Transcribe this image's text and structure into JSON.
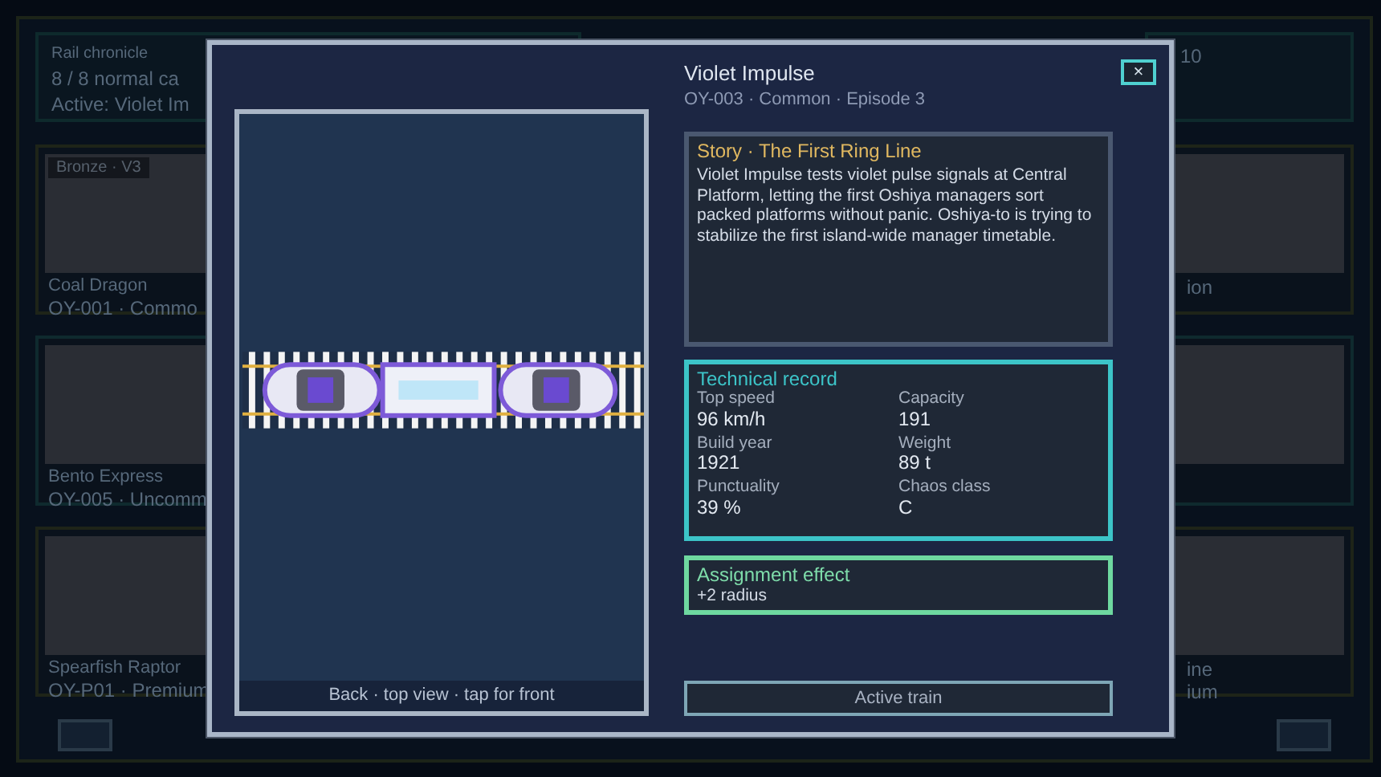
{
  "background": {
    "header": {
      "lines": [
        "Rail chronicle",
        "8 / 8 normal ca",
        "Active: Violet Im"
      ],
      "right_text": "10"
    },
    "left_cards": [
      {
        "badge": "Bronze · V3",
        "name": "Coal Dragon",
        "code": "OY-001 · Commo",
        "highlighted": false
      },
      {
        "name": "Bento Express",
        "code": "OY-005 · Uncomm",
        "highlighted": true
      },
      {
        "name": "Spearfish Raptor",
        "code": "OY-P01 · Premium",
        "highlighted": false
      }
    ],
    "right_cards": [
      {
        "lines": [
          "ion"
        ],
        "highlighted": false
      },
      {
        "highlighted": true
      },
      {
        "lines": [
          "ine",
          "ium"
        ],
        "highlighted": false
      }
    ]
  },
  "modal": {
    "title": "Violet Impulse",
    "subtitle": "OY-003 · Common · Episode 3",
    "close": "×",
    "preview_caption": "Back · top view · tap for front",
    "story": {
      "title": "Story · The First Ring Line",
      "text": "Violet Impulse tests violet pulse signals at Central Platform, letting the first Oshiya managers sort packed platforms without panic. Oshiya-to is trying to stabilize the first island-wide manager timetable."
    },
    "technical_record": {
      "title": "Technical record",
      "items": [
        {
          "label": "Top speed",
          "value": "96 km/h"
        },
        {
          "label": "Capacity",
          "value": "191"
        },
        {
          "label": "Build year",
          "value": "1921"
        },
        {
          "label": "Weight",
          "value": "89 t"
        },
        {
          "label": "Punctuality",
          "value": "39 %"
        },
        {
          "label": "Chaos class",
          "value": "C"
        }
      ]
    },
    "assignment": {
      "title": "Assignment effect",
      "text": "+2 radius"
    },
    "action_button": "Active train"
  }
}
